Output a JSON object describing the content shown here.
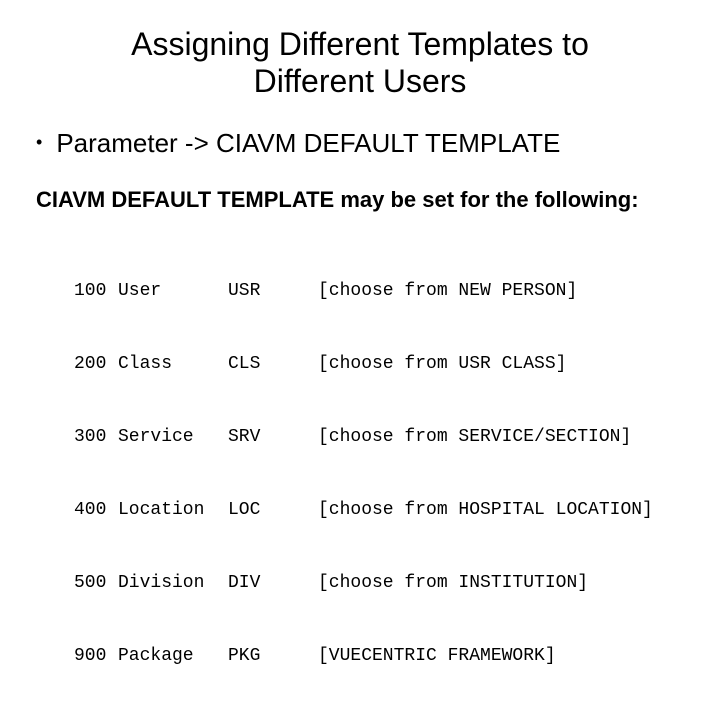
{
  "title_line1": "Assigning Different Templates to",
  "title_line2": "Different Users",
  "bullet1": "Parameter -> CIAVM DEFAULT TEMPLATE",
  "subhead": "CIAVM DEFAULT TEMPLATE may be set for the following:",
  "rows": [
    {
      "num": "100",
      "name": "User",
      "code": "USR",
      "desc": "[choose from NEW PERSON]"
    },
    {
      "num": "200",
      "name": "Class",
      "code": "CLS",
      "desc": "[choose from USR CLASS]"
    },
    {
      "num": "300",
      "name": "Service",
      "code": "SRV",
      "desc": "[choose from SERVICE/SECTION]"
    },
    {
      "num": "400",
      "name": "Location",
      "code": "LOC",
      "desc": "[choose from HOSPITAL LOCATION]"
    },
    {
      "num": "500",
      "name": "Division",
      "code": "DIV",
      "desc": "[choose from INSTITUTION]"
    },
    {
      "num": "900",
      "name": "Package",
      "code": "PKG",
      "desc": "[VUECENTRIC FRAMEWORK]"
    }
  ]
}
